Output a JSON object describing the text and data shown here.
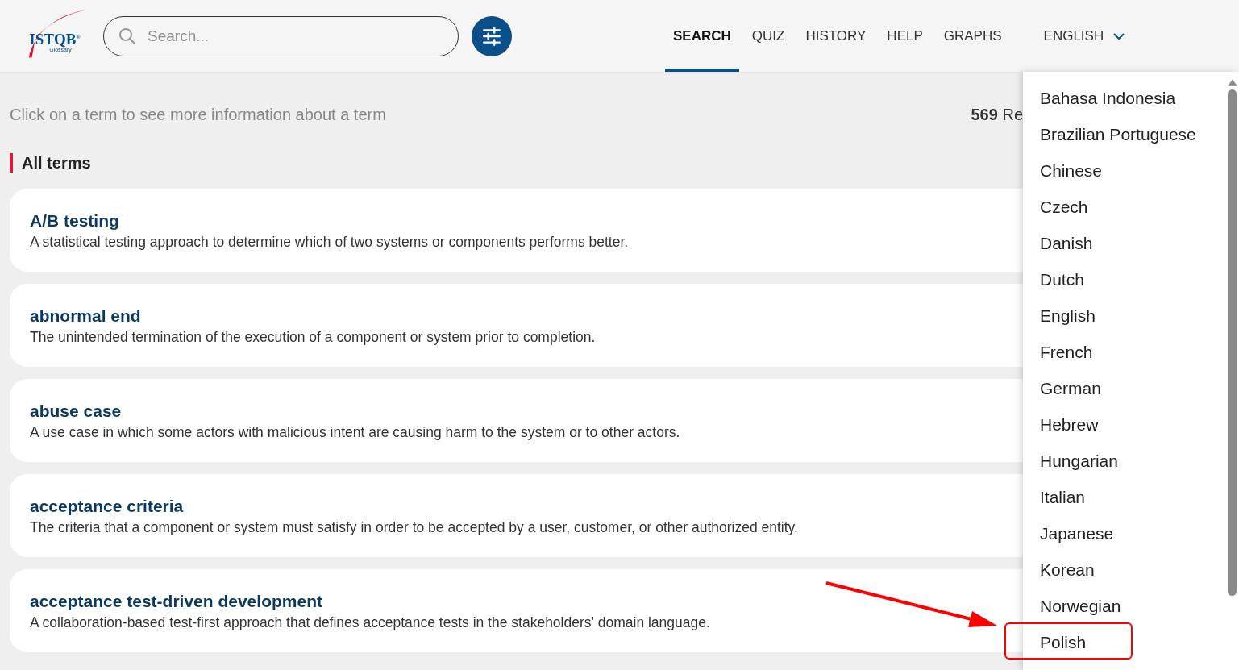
{
  "logo": {
    "name": "ISTQB",
    "mark": "®",
    "subtitle": "Glossary"
  },
  "search": {
    "placeholder": "Search..."
  },
  "nav": [
    {
      "label": "SEARCH",
      "selected": true
    },
    {
      "label": "QUIZ",
      "selected": false
    },
    {
      "label": "HISTORY",
      "selected": false
    },
    {
      "label": "HELP",
      "selected": false
    },
    {
      "label": "GRAPHS",
      "selected": false
    }
  ],
  "language": {
    "label": "ENGLISH",
    "expanded": true
  },
  "hint": "Click on a term to see more information about a term",
  "result_count": "**569** Re",
  "section_title": "All terms",
  "terms": [
    {
      "title": "A/B testing",
      "definition": "A statistical testing approach to determine which of two systems or components performs better."
    },
    {
      "title": "abnormal end",
      "definition": "The unintended termination of the execution of a component or system prior to completion."
    },
    {
      "title": "abuse case",
      "definition": "A use case in which some actors with malicious intent are causing harm to the system or to other actors."
    },
    {
      "title": "acceptance criteria",
      "definition": "The criteria that a component or system must satisfy in order to be accepted by a user, customer, or other authorized entity."
    },
    {
      "title": "acceptance test-driven development",
      "definition": "A collaboration-based test-first approach that defines acceptance tests in the stakeholders' domain language."
    }
  ],
  "languages": [
    {
      "label": "Bahasa Indonesia",
      "highlighted": false
    },
    {
      "label": "Brazilian Portuguese",
      "highlighted": false
    },
    {
      "label": "Chinese",
      "highlighted": false
    },
    {
      "label": "Czech",
      "highlighted": false
    },
    {
      "label": "Danish",
      "highlighted": false
    },
    {
      "label": "Dutch",
      "highlighted": false
    },
    {
      "label": "English",
      "highlighted": false
    },
    {
      "label": "French",
      "highlighted": false
    },
    {
      "label": "German",
      "highlighted": false
    },
    {
      "label": "Hebrew",
      "highlighted": false
    },
    {
      "label": "Hungarian",
      "highlighted": false
    },
    {
      "label": "Italian",
      "highlighted": false
    },
    {
      "label": "Japanese",
      "highlighted": false
    },
    {
      "label": "Korean",
      "highlighted": false
    },
    {
      "label": "Norwegian",
      "highlighted": false
    },
    {
      "label": "Polish",
      "highlighted": true
    }
  ]
}
